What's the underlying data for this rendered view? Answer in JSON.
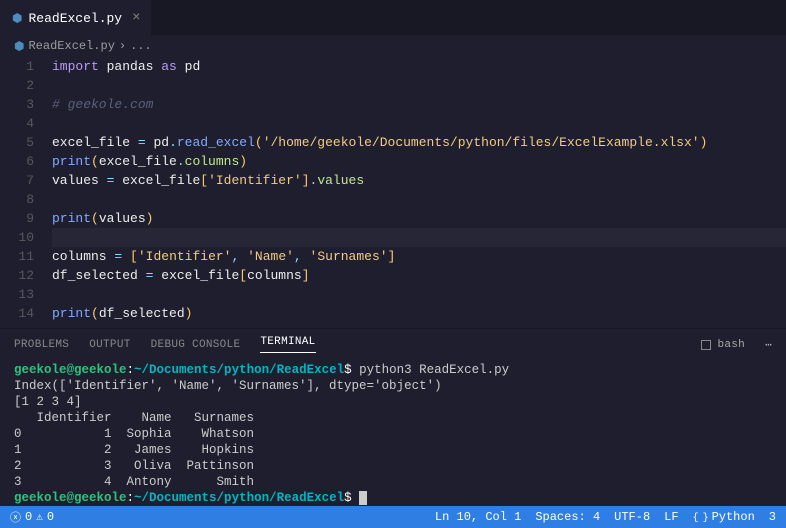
{
  "tab": {
    "filename": "ReadExcel.py"
  },
  "breadcrumb": {
    "filename": "ReadExcel.py",
    "sep": "›",
    "more": "..."
  },
  "editor": {
    "lines": [
      {
        "n": 1,
        "segs": [
          {
            "c": "kw",
            "t": "import"
          },
          {
            "c": "",
            "t": " "
          },
          {
            "c": "id",
            "t": "pandas"
          },
          {
            "c": "",
            "t": " "
          },
          {
            "c": "kw",
            "t": "as"
          },
          {
            "c": "",
            "t": " "
          },
          {
            "c": "id",
            "t": "pd"
          }
        ]
      },
      {
        "n": 2,
        "segs": []
      },
      {
        "n": 3,
        "segs": [
          {
            "c": "cmt",
            "t": "# geekole.com"
          }
        ]
      },
      {
        "n": 4,
        "segs": []
      },
      {
        "n": 5,
        "segs": [
          {
            "c": "id",
            "t": "excel_file"
          },
          {
            "c": "",
            "t": " "
          },
          {
            "c": "op",
            "t": "="
          },
          {
            "c": "",
            "t": " "
          },
          {
            "c": "id",
            "t": "pd"
          },
          {
            "c": "op",
            "t": "."
          },
          {
            "c": "fn",
            "t": "read_excel"
          },
          {
            "c": "pun",
            "t": "("
          },
          {
            "c": "str",
            "t": "'/home/geekole/Documents/python/files/ExcelExample.xlsx'"
          },
          {
            "c": "pun",
            "t": ")"
          }
        ]
      },
      {
        "n": 6,
        "segs": [
          {
            "c": "fn",
            "t": "print"
          },
          {
            "c": "pun",
            "t": "("
          },
          {
            "c": "id",
            "t": "excel_file"
          },
          {
            "c": "op",
            "t": "."
          },
          {
            "c": "prop",
            "t": "columns"
          },
          {
            "c": "pun",
            "t": ")"
          }
        ]
      },
      {
        "n": 7,
        "segs": [
          {
            "c": "id",
            "t": "values"
          },
          {
            "c": "",
            "t": " "
          },
          {
            "c": "op",
            "t": "="
          },
          {
            "c": "",
            "t": " "
          },
          {
            "c": "id",
            "t": "excel_file"
          },
          {
            "c": "pun",
            "t": "["
          },
          {
            "c": "str",
            "t": "'Identifier'"
          },
          {
            "c": "pun",
            "t": "]"
          },
          {
            "c": "op",
            "t": "."
          },
          {
            "c": "prop",
            "t": "values"
          }
        ]
      },
      {
        "n": 8,
        "segs": []
      },
      {
        "n": 9,
        "segs": [
          {
            "c": "fn",
            "t": "print"
          },
          {
            "c": "pun",
            "t": "("
          },
          {
            "c": "id",
            "t": "values"
          },
          {
            "c": "pun",
            "t": ")"
          }
        ]
      },
      {
        "n": 10,
        "current": true,
        "segs": []
      },
      {
        "n": 11,
        "segs": [
          {
            "c": "id",
            "t": "columns"
          },
          {
            "c": "",
            "t": " "
          },
          {
            "c": "op",
            "t": "="
          },
          {
            "c": "",
            "t": " "
          },
          {
            "c": "pun",
            "t": "["
          },
          {
            "c": "str",
            "t": "'Identifier'"
          },
          {
            "c": "op",
            "t": ","
          },
          {
            "c": "",
            "t": " "
          },
          {
            "c": "str",
            "t": "'Name'"
          },
          {
            "c": "op",
            "t": ","
          },
          {
            "c": "",
            "t": " "
          },
          {
            "c": "str",
            "t": "'Surnames'"
          },
          {
            "c": "pun",
            "t": "]"
          }
        ]
      },
      {
        "n": 12,
        "segs": [
          {
            "c": "id",
            "t": "df_selected"
          },
          {
            "c": "",
            "t": " "
          },
          {
            "c": "op",
            "t": "="
          },
          {
            "c": "",
            "t": " "
          },
          {
            "c": "id",
            "t": "excel_file"
          },
          {
            "c": "pun",
            "t": "["
          },
          {
            "c": "id",
            "t": "columns"
          },
          {
            "c": "pun",
            "t": "]"
          }
        ]
      },
      {
        "n": 13,
        "segs": []
      },
      {
        "n": 14,
        "segs": [
          {
            "c": "fn",
            "t": "print"
          },
          {
            "c": "pun",
            "t": "("
          },
          {
            "c": "id",
            "t": "df_selected"
          },
          {
            "c": "pun",
            "t": ")"
          }
        ]
      }
    ]
  },
  "panel": {
    "tabs": [
      "PROBLEMS",
      "OUTPUT",
      "DEBUG CONSOLE",
      "TERMINAL"
    ],
    "active": 3,
    "shell": "bash"
  },
  "terminal": {
    "user": "geekole@geekole",
    "path": "~/Documents/python/ReadExcel",
    "command": " python3 ReadExcel.py",
    "out1": "Index(['Identifier', 'Name', 'Surnames'], dtype='object')",
    "out2": "[1 2 3 4]",
    "out3": "   Identifier    Name   Surnames",
    "out4": "0           1  Sophia    Whatson",
    "out5": "1           2   James    Hopkins",
    "out6": "2           3   Oliva  Pattinson",
    "out7": "3           4  Antony      Smith"
  },
  "status": {
    "errors": "0",
    "warnings": "0",
    "position": "Ln 10, Col 1",
    "spaces": "Spaces: 4",
    "encoding": "UTF-8",
    "eol": "LF",
    "language": "Python",
    "notifications": "3"
  }
}
